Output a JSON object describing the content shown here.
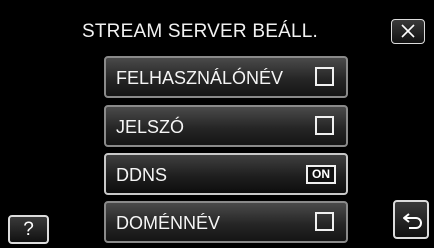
{
  "header": {
    "title": "STREAM SERVER BEÁLL.",
    "close_icon": "close-icon"
  },
  "menu": {
    "items": [
      {
        "label": "FELHASZNÁLÓNÉV",
        "control": "checkbox",
        "checked": false
      },
      {
        "label": "JELSZÓ",
        "control": "checkbox",
        "checked": false
      },
      {
        "label": "DDNS",
        "control": "toggle",
        "value": "ON"
      },
      {
        "label": "DOMÉNNÉV",
        "control": "checkbox",
        "checked": false
      }
    ],
    "selected_index": 2
  },
  "footer": {
    "help_label": "?",
    "back_icon": "return-arrow-icon"
  },
  "colors": {
    "background": "#000000",
    "button_border": "#8a8a8a",
    "text": "#f5f5f5"
  }
}
